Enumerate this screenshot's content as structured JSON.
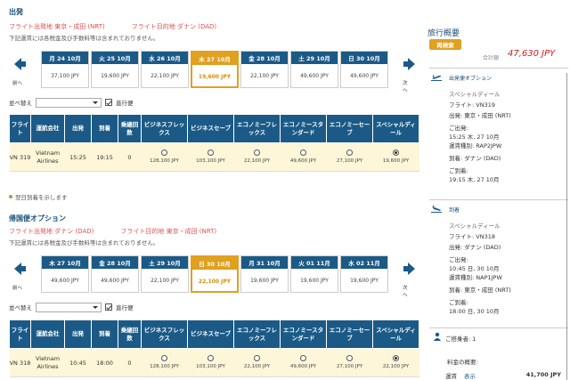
{
  "outbound": {
    "title": "出発",
    "from": "フライト出発地 東京・成田 (NRT)",
    "to": "フライト目的地 ダナン (DAD)",
    "note": "下記運賃には各税金及び手数料等は含まれておりません。",
    "prev": "前へ",
    "next": "次へ",
    "dates": [
      {
        "day": "月 24 10月",
        "price": "37,100 JPY",
        "selected": false
      },
      {
        "day": "火 25 10月",
        "price": "19,600 JPY",
        "selected": false
      },
      {
        "day": "水 26 10月",
        "price": "22,100 JPY",
        "selected": false
      },
      {
        "day": "木 27 10月",
        "price": "19,600 JPY",
        "selected": true
      },
      {
        "day": "金 28 10月",
        "price": "22,100 JPY",
        "selected": false
      },
      {
        "day": "土 29 10月",
        "price": "49,600 JPY",
        "selected": false
      },
      {
        "day": "日 30 10月",
        "price": "49,600 JPY",
        "selected": false
      }
    ],
    "sort_label": "並べ替え",
    "direct_label": "直行便",
    "flight": {
      "no": "VN 319",
      "airline": "Vietnam Airlines",
      "dep": "15:25",
      "arr": "19:15",
      "stops": "0",
      "fares": [
        "128,100 JPY",
        "103,100 JPY",
        "22,100 JPY",
        "49,600 JPY",
        "27,100 JPY",
        "19,600 JPY"
      ],
      "selected_fare": 5
    }
  },
  "legend": "翌日到着を示します",
  "inbound": {
    "title": "帰国便オプション",
    "from": "フライト出発地 ダナン (DAD)",
    "to": "フライト目的地 東京・成田 (NRT)",
    "note": "下記運賃には各税金及び手数料等は含まれておりません。",
    "prev": "前へ",
    "next": "次へ",
    "dates": [
      {
        "day": "木 27 10月",
        "price": "49,600 JPY",
        "selected": false
      },
      {
        "day": "金 28 10月",
        "price": "49,600 JPY",
        "selected": false
      },
      {
        "day": "土 29 10月",
        "price": "22,100 JPY",
        "selected": false
      },
      {
        "day": "日 30 10月",
        "price": "22,100 JPY",
        "selected": true
      },
      {
        "day": "月 31 10月",
        "price": "19,600 JPY",
        "selected": false
      },
      {
        "day": "火 01 11月",
        "price": "19,600 JPY",
        "selected": false
      },
      {
        "day": "水 02 11月",
        "price": "19,600 JPY",
        "selected": false
      }
    ],
    "sort_label": "並べ替え",
    "direct_label": "直行便",
    "flight": {
      "no": "VN 318",
      "airline": "Vietnam Airlines",
      "dep": "10:45",
      "arr": "18:00",
      "stops": "0",
      "fares": [
        "128,100 JPY",
        "103,100 JPY",
        "22,100 JPY",
        "49,600 JPY",
        "27,100 JPY",
        "22,100 JPY"
      ],
      "selected_fare": 5
    }
  },
  "table_headers": [
    "フライト",
    "運航会社",
    "出発",
    "到着",
    "乗継回数",
    "ビジネスフレックス",
    "ビジネスセーブ",
    "エコノミーフレックス",
    "エコノミースタンダード",
    "エコノミーセーブ",
    "スペシャルディール"
  ],
  "summary": {
    "title": "旅行概要",
    "research": "再検索",
    "total_label": "合計額",
    "total": "47,630 JPY",
    "out_head": "出発便オプション",
    "out_lines": [
      "スペシャルディール",
      "フライト: VN319",
      "出発: 東京・成田 (NRT)",
      "ご出発:",
      "15:25 木, 27 10月",
      "運賃種別: RAP2JPW",
      "到着: ダナン (DAD)",
      "ご到着:",
      "19:15 木, 27 10月"
    ],
    "in_head": "到着",
    "in_lines": [
      "スペシャルディール",
      "フライト: VN318",
      "出発: ダナン (DAD)",
      "ご出発:",
      "10:45 日, 30 10月",
      "運賃種別: NAP1JPW",
      "到着: 東京・成田 (NRT)",
      "ご到着:",
      "18:00 日, 30 10月"
    ],
    "passengers": "ご搭乗者: 1",
    "fare_summary": "料金の概要:",
    "fare_type": "運賃",
    "show": "表示",
    "fare_amount": "41,700 JPY"
  },
  "colors": {
    "header": "#1b5a86",
    "selected": "#e0a020",
    "row": "#fdf6d8",
    "total": "#d81818"
  }
}
